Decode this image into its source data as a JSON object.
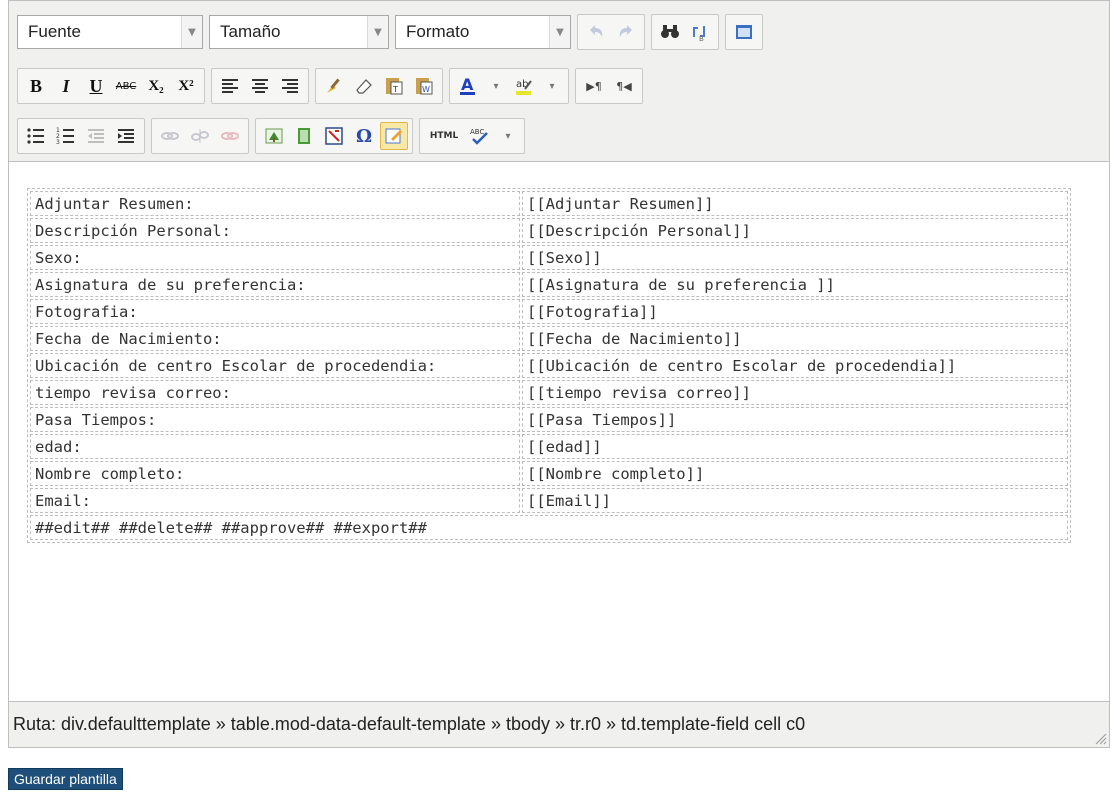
{
  "toolbar": {
    "font_select": "Fuente",
    "size_select": "Tamaño",
    "format_select": "Formato",
    "bold": "B",
    "italic": "I",
    "underline": "U",
    "strikethrough": "ABC",
    "subscript": "X₂",
    "superscript": "X²",
    "html_button": "HTML",
    "spell_label": "ABC",
    "ltr": "▶¶",
    "rtl": "¶◀",
    "special_char": "Ω"
  },
  "template_rows": [
    {
      "label": "Adjuntar Resumen:",
      "field": "[[Adjuntar Resumen]]"
    },
    {
      "label": "Descripción Personal:",
      "field": "[[Descripción Personal]]"
    },
    {
      "label": "Sexo:",
      "field": "[[Sexo]]"
    },
    {
      "label": "Asignatura de su preferencia:",
      "field": "[[Asignatura de su preferencia ]]"
    },
    {
      "label": "Fotografia:",
      "field": "[[Fotografia]]"
    },
    {
      "label": "Fecha de Nacimiento:",
      "field": "[[Fecha de Nacimiento]]"
    },
    {
      "label": "Ubicación de centro Escolar de procedendia:",
      "field": "[[Ubicación de centro Escolar de procedendia]]"
    },
    {
      "label": "tiempo revisa correo:",
      "field": "[[tiempo revisa correo]]"
    },
    {
      "label": "Pasa Tiempos:",
      "field": "[[Pasa Tiempos]]"
    },
    {
      "label": "edad:",
      "field": "[[edad]]"
    },
    {
      "label": "Nombre completo:",
      "field": "[[Nombre completo]]"
    },
    {
      "label": "Email:",
      "field": "[[Email]]"
    }
  ],
  "actions_row": "##edit## ##delete## ##approve## ##export##",
  "status_path": "Ruta: div.defaulttemplate » table.mod-data-default-template » tbody » tr.r0 » td.template-field cell c0",
  "save_button": "Guardar plantilla",
  "colors": {
    "toolbar_bg": "#f0f0ee",
    "save_button_bg": "#1e4f7a",
    "text_color_icon": "#1f3fbf",
    "highlight_color_icon": "#e5e52b"
  }
}
